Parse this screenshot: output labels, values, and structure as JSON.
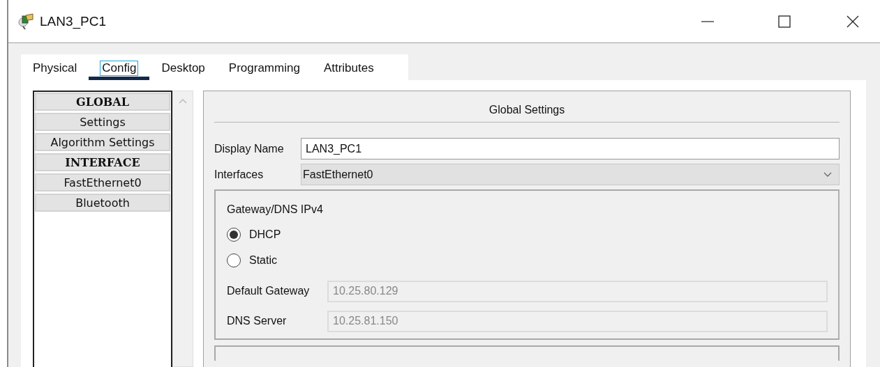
{
  "window": {
    "title": "LAN3_PC1"
  },
  "tabs": [
    {
      "label": "Physical",
      "selected": false
    },
    {
      "label": "Config",
      "selected": true
    },
    {
      "label": "Desktop",
      "selected": false
    },
    {
      "label": "Programming",
      "selected": false
    },
    {
      "label": "Attributes",
      "selected": false
    }
  ],
  "sidebar": {
    "items": [
      {
        "label": "GLOBAL",
        "kind": "header"
      },
      {
        "label": "Settings",
        "kind": "item"
      },
      {
        "label": "Algorithm Settings",
        "kind": "item"
      },
      {
        "label": "INTERFACE",
        "kind": "header"
      },
      {
        "label": "FastEthernet0",
        "kind": "item"
      },
      {
        "label": "Bluetooth",
        "kind": "item"
      }
    ]
  },
  "global_settings": {
    "title": "Global Settings",
    "display_name": {
      "label": "Display Name",
      "value": "LAN3_PC1"
    },
    "interfaces": {
      "label": "Interfaces",
      "value": "FastEthernet0"
    },
    "gateway_dns": {
      "title": "Gateway/DNS IPv4",
      "modes": [
        {
          "label": "DHCP",
          "selected": true
        },
        {
          "label": "Static",
          "selected": false
        }
      ],
      "fields": [
        {
          "label": "Default Gateway",
          "value": "10.25.80.129",
          "disabled": true
        },
        {
          "label": "DNS Server",
          "value": "10.25.81.150",
          "disabled": true
        }
      ]
    }
  }
}
